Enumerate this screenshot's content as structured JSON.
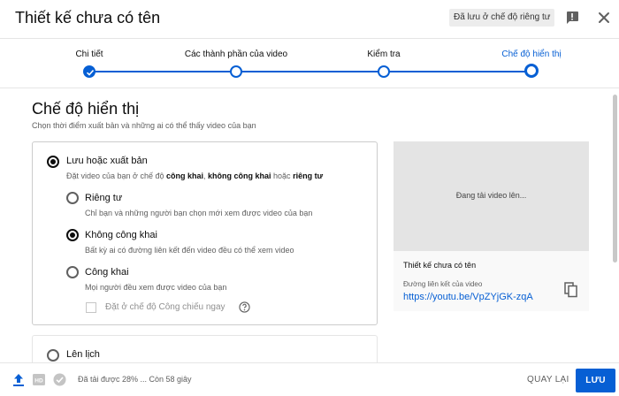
{
  "header": {
    "title": "Thiết kế chưa có tên",
    "saved_badge": "Đã lưu ở chế độ riêng tư"
  },
  "stepper": {
    "steps": [
      {
        "label": "Chi tiết",
        "state": "done"
      },
      {
        "label": "Các thành phần của video",
        "state": "pending"
      },
      {
        "label": "Kiểm tra",
        "state": "pending"
      },
      {
        "label": "Chế độ hiển thị",
        "state": "current"
      }
    ]
  },
  "main": {
    "title": "Chế độ hiển thị",
    "subtitle": "Chọn thời điểm xuất bản và những ai có thể thấy video của bạn",
    "save_publish": {
      "label": "Lưu hoặc xuất bản",
      "desc_prefix": "Đặt video của bạn ở chế độ ",
      "desc_public": "công khai",
      "desc_sep": ", ",
      "desc_unlisted": "không công khai",
      "desc_or": " hoặc ",
      "desc_private": "riêng tư",
      "selected": true
    },
    "options": [
      {
        "label": "Riêng tư",
        "desc": "Chỉ bạn và những người bạn chọn mới xem được video của bạn",
        "selected": false
      },
      {
        "label": "Không công khai",
        "desc": "Bất kỳ ai có đường liên kết đến video đều có thể xem video",
        "selected": true
      },
      {
        "label": "Công khai",
        "desc": "Mọi người đều xem được video của bạn",
        "selected": false
      }
    ],
    "premiere_label": "Đặt ở chế độ Công chiếu ngay",
    "schedule": {
      "label": "Lên lịch",
      "selected": false
    }
  },
  "preview": {
    "status": "Đang tải video lên...",
    "video_title": "Thiết kế chưa có tên",
    "link_label": "Đường liên kết của video",
    "link": "https://youtu.be/VpZYjGK-zqA"
  },
  "footer": {
    "upload_status": "Đã tải được 28% ... Còn 58 giây",
    "upload_progress_percent": 28,
    "back_label": "QUAY LẠI",
    "save_label": "LƯU"
  },
  "colors": {
    "accent": "#065fd4",
    "text_primary": "#0d0d0d",
    "text_secondary": "#606060"
  },
  "icons": [
    "feedback-icon",
    "close-icon",
    "check-icon",
    "help-icon",
    "copy-icon",
    "upload-icon",
    "hd-icon",
    "check-circle-icon"
  ]
}
